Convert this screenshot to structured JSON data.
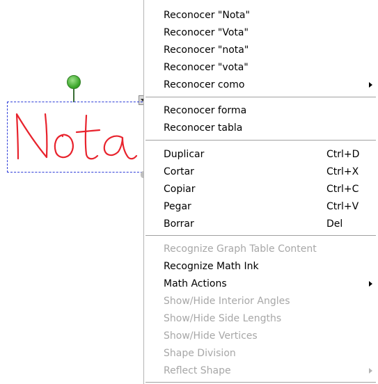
{
  "canvas": {
    "ink_word": "Nota"
  },
  "menu": {
    "groups": [
      [
        {
          "label": "Reconocer \"Nota\"",
          "enabled": true
        },
        {
          "label": "Reconocer \"Vota\"",
          "enabled": true
        },
        {
          "label": "Reconocer \"nota\"",
          "enabled": true
        },
        {
          "label": "Reconocer \"vota\"",
          "enabled": true
        },
        {
          "label": "Reconocer como",
          "enabled": true,
          "submenu": true
        }
      ],
      [
        {
          "label": "Reconocer forma",
          "enabled": true
        },
        {
          "label": "Reconocer tabla",
          "enabled": true
        }
      ],
      [
        {
          "label": "Duplicar",
          "shortcut": "Ctrl+D",
          "enabled": true
        },
        {
          "label": "Cortar",
          "shortcut": "Ctrl+X",
          "enabled": true
        },
        {
          "label": "Copiar",
          "shortcut": "Ctrl+C",
          "enabled": true
        },
        {
          "label": "Pegar",
          "shortcut": "Ctrl+V",
          "enabled": true
        },
        {
          "label": "Borrar",
          "shortcut": "Del",
          "enabled": true
        }
      ],
      [
        {
          "label": "Recognize Graph Table Content",
          "enabled": false
        },
        {
          "label": "Recognize Math Ink",
          "enabled": true
        },
        {
          "label": "Math Actions",
          "enabled": true,
          "submenu": true
        },
        {
          "label": "Show/Hide Interior Angles",
          "enabled": false
        },
        {
          "label": "Show/Hide Side Lengths",
          "enabled": false
        },
        {
          "label": "Show/Hide Vertices",
          "enabled": false
        },
        {
          "label": "Shape Division",
          "enabled": false
        },
        {
          "label": "Reflect Shape",
          "enabled": false,
          "submenu": true
        }
      ]
    ]
  },
  "colors": {
    "ink": "#e8232d",
    "selection_border": "#2b3bd8",
    "disabled_text": "#a7a7a7"
  }
}
